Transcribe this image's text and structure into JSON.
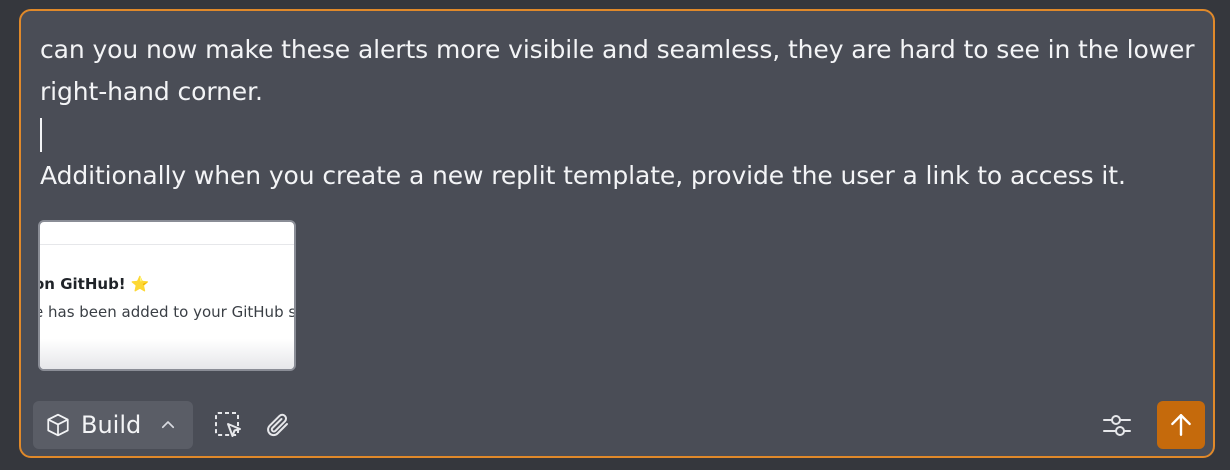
{
  "message": {
    "line1": "can you now make these alerts more visibile and seamless, they are hard to see in the lower",
    "line2": "right-hand corner.",
    "line3": "Additionally when you create a new replit template, provide the user a link to access it."
  },
  "attachment": {
    "title": "on GitHub!",
    "title_emoji": "⭐",
    "body": "e has been added to your GitHub s"
  },
  "toolbar": {
    "mode_label": "Build",
    "mode_icon": "cube-icon",
    "select_icon": "select-region-icon",
    "attach_icon": "paperclip-icon",
    "settings_icon": "sliders-icon",
    "send_icon": "arrow-up-icon"
  },
  "colors": {
    "accent": "#e0892a",
    "send_bg": "#c56a0c",
    "panel_bg": "#4a4d56"
  }
}
